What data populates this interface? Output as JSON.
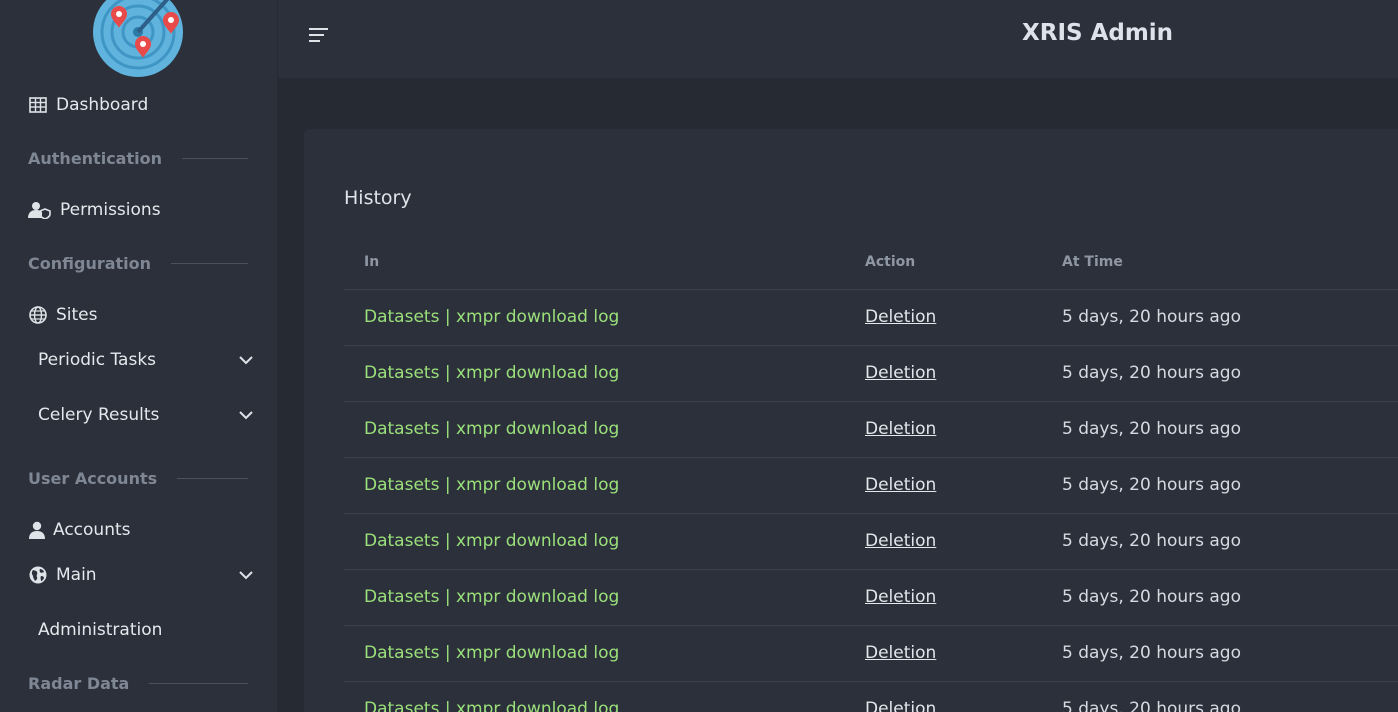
{
  "app": {
    "brand": "XRIS Admin"
  },
  "sidebar": {
    "dashboard": "Dashboard",
    "sections": {
      "authentication": "Authentication",
      "configuration": "Configuration",
      "user_accounts": "User Accounts",
      "radar_data": "Radar Data"
    },
    "permissions": "Permissions",
    "sites": "Sites",
    "periodic_tasks": "Periodic Tasks",
    "celery_results": "Celery Results",
    "accounts": "Accounts",
    "main": "Main",
    "administration": "Administration"
  },
  "history": {
    "title": "History",
    "columns": {
      "in": "In",
      "action": "Action",
      "at_time": "At Time"
    },
    "rows": [
      {
        "in": "Datasets | xmpr download log",
        "action": "Deletion",
        "time": "5 days, 20 hours ago"
      },
      {
        "in": "Datasets | xmpr download log",
        "action": "Deletion",
        "time": "5 days, 20 hours ago"
      },
      {
        "in": "Datasets | xmpr download log",
        "action": "Deletion",
        "time": "5 days, 20 hours ago"
      },
      {
        "in": "Datasets | xmpr download log",
        "action": "Deletion",
        "time": "5 days, 20 hours ago"
      },
      {
        "in": "Datasets | xmpr download log",
        "action": "Deletion",
        "time": "5 days, 20 hours ago"
      },
      {
        "in": "Datasets | xmpr download log",
        "action": "Deletion",
        "time": "5 days, 20 hours ago"
      },
      {
        "in": "Datasets | xmpr download log",
        "action": "Deletion",
        "time": "5 days, 20 hours ago"
      },
      {
        "in": "Datasets | xmpr download log",
        "action": "Deletion",
        "time": "5 days, 20 hours ago"
      }
    ]
  },
  "colors": {
    "link_green": "#9be07a",
    "sidebar_bg": "#2b303b",
    "page_bg": "#252a33"
  }
}
